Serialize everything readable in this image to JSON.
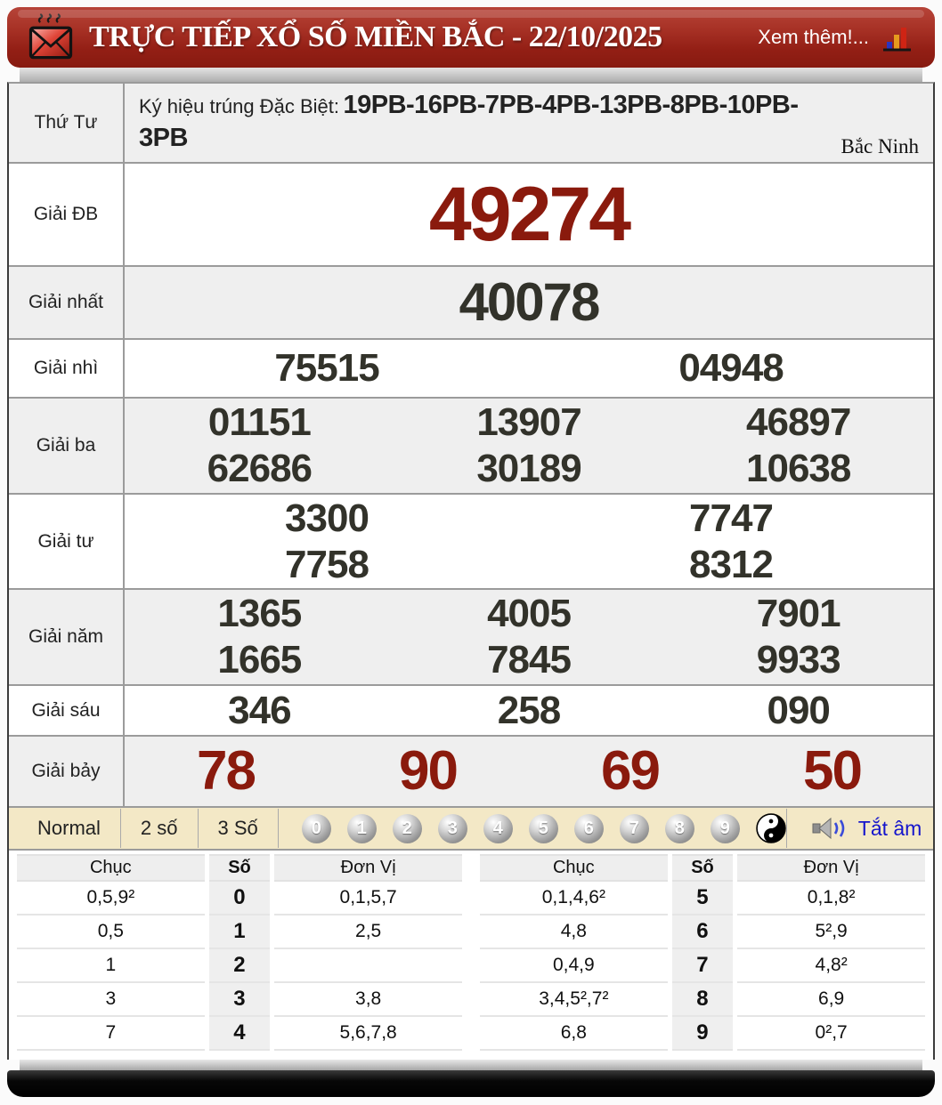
{
  "header": {
    "title": "TRỰC TIẾP XỔ SỐ MIỀN BẮC - 22/10/2025",
    "more_label": "Xem thêm!..."
  },
  "info_row": {
    "day": "Thứ Tư",
    "symbol_label": "Ký hiệu trúng Đặc Biệt:",
    "symbols_line1": "19PB-16PB-7PB-4PB-13PB-8PB-10PB-",
    "symbols_line2": "3PB",
    "province": "Bắc Ninh"
  },
  "prizes": {
    "special": {
      "label": "Giải ĐB",
      "values": [
        "49274"
      ]
    },
    "first": {
      "label": "Giải nhất",
      "values": [
        "40078"
      ]
    },
    "second": {
      "label": "Giải nhì",
      "values": [
        "75515",
        "04948"
      ]
    },
    "third": {
      "label": "Giải ba",
      "line1": [
        "01151",
        "13907",
        "46897"
      ],
      "line2": [
        "62686",
        "30189",
        "10638"
      ]
    },
    "fourth": {
      "label": "Giải tư",
      "line1": [
        "3300",
        "7747"
      ],
      "line2": [
        "7758",
        "8312"
      ]
    },
    "fifth": {
      "label": "Giải năm",
      "line1": [
        "1365",
        "4005",
        "7901"
      ],
      "line2": [
        "1665",
        "7845",
        "9933"
      ]
    },
    "sixth": {
      "label": "Giải sáu",
      "values": [
        "346",
        "258",
        "090"
      ]
    },
    "seventh": {
      "label": "Giải bảy",
      "values": [
        "78",
        "90",
        "69",
        "50"
      ]
    }
  },
  "toolbar": {
    "modes": [
      "Normal",
      "2 số",
      "3 Số"
    ],
    "digits": [
      "0",
      "1",
      "2",
      "3",
      "4",
      "5",
      "6",
      "7",
      "8",
      "9"
    ],
    "mute_label": "Tắt âm"
  },
  "stats": {
    "headers": [
      "Chục",
      "Số",
      "Đơn Vị"
    ],
    "left_rows": [
      {
        "chuc": "0,5,9²",
        "so": "0",
        "donvi": "0,1,5,7"
      },
      {
        "chuc": "0,5",
        "so": "1",
        "donvi": "2,5"
      },
      {
        "chuc": "1",
        "so": "2",
        "donvi": ""
      },
      {
        "chuc": "3",
        "so": "3",
        "donvi": "3,8"
      },
      {
        "chuc": "7",
        "so": "4",
        "donvi": "5,6,7,8"
      }
    ],
    "right_rows": [
      {
        "chuc": "0,1,4,6²",
        "so": "5",
        "donvi": "0,1,8²"
      },
      {
        "chuc": "4,8",
        "so": "6",
        "donvi": "5²,9"
      },
      {
        "chuc": "0,4,9",
        "so": "7",
        "donvi": "4,8²"
      },
      {
        "chuc": "3,4,5²,7²",
        "so": "8",
        "donvi": "6,9"
      },
      {
        "chuc": "6,8",
        "so": "9",
        "donvi": "0²,7"
      }
    ]
  },
  "colors": {
    "header_red": "#a83226",
    "prize_red": "#8a1a0d",
    "toolbar_beige": "#f3e8c6",
    "link_blue": "#1515cc"
  }
}
